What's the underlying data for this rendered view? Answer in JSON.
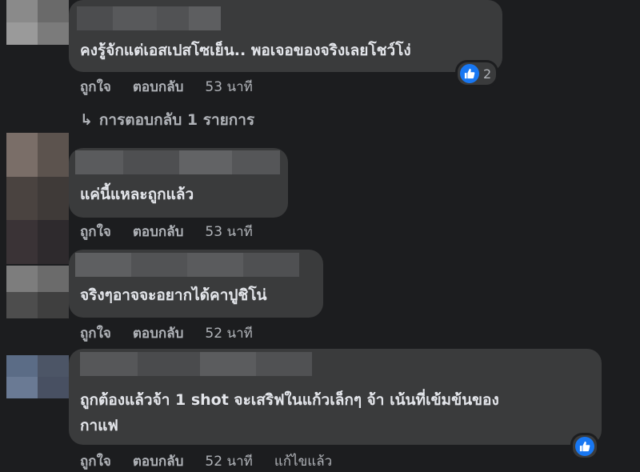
{
  "comments": [
    {
      "text": "คงรู้จักแต่เอสเปสโซเย็น.. พอเจอของจริงเลยโชว์โง่",
      "actions": {
        "like": "ถูกใจ",
        "reply": "ตอบกลับ",
        "time": "53 นาที"
      },
      "reaction_count": "2",
      "reply_summary": "การตอบกลับ 1 รายการ"
    },
    {
      "text": "แค่นี้แหละถูกแล้ว",
      "actions": {
        "like": "ถูกใจ",
        "reply": "ตอบกลับ",
        "time": "53 นาที"
      }
    },
    {
      "text": "จริงๆอาจจะอยากได้คาปูชิโน่",
      "actions": {
        "like": "ถูกใจ",
        "reply": "ตอบกลับ",
        "time": "52 นาที"
      }
    },
    {
      "text_line1": "ถูกต้องแล้วจ้า 1 shot จะเสริฟในแก้วเล็กๆ จ้า เน้นที่เข้มข้นของ",
      "text_line2": "กาแฟ",
      "actions": {
        "like": "ถูกใจ",
        "reply": "ตอบกลับ",
        "time": "52 นาที",
        "edited": "แก้ไขแล้ว"
      }
    }
  ],
  "colors": {
    "background": "#1c1d1f",
    "bubble": "#3a3b3c",
    "like_blue": "#1877f2",
    "secondary_text": "#b0b3b8"
  }
}
